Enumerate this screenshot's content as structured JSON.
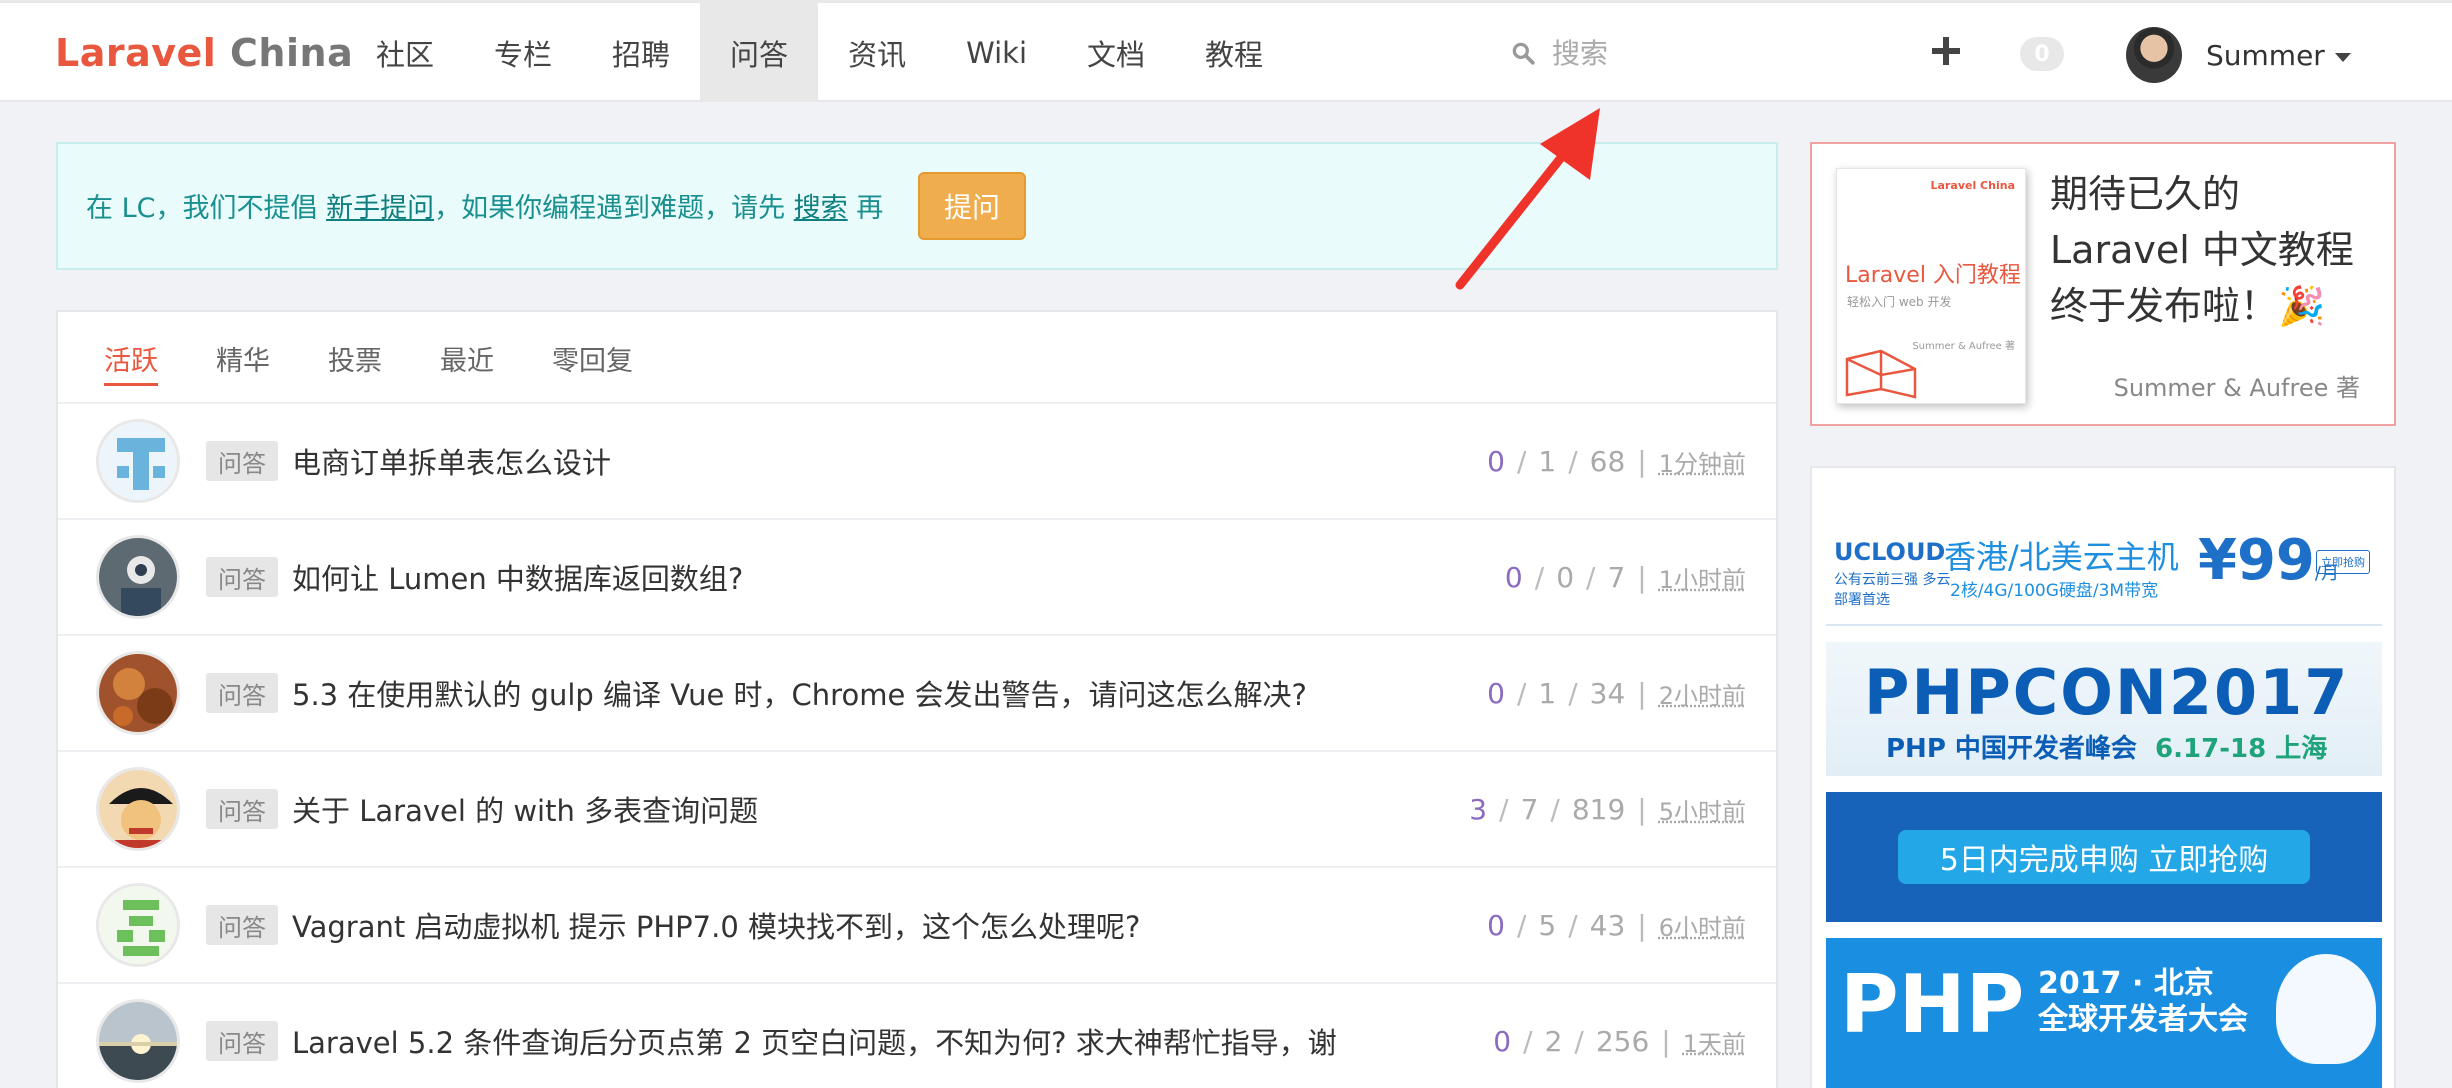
{
  "brand": {
    "part1": "Laravel",
    "part2": "China"
  },
  "nav": {
    "items": [
      "社区",
      "专栏",
      "招聘",
      "问答",
      "资讯",
      "Wiki",
      "文档",
      "教程"
    ],
    "active_index": 3
  },
  "search": {
    "placeholder": "搜索"
  },
  "header": {
    "notification_count": "0",
    "username": "Summer"
  },
  "notice": {
    "text_before": "在 LC，我们不提倡",
    "link1": "新手提问",
    "text_middle": "，如果你编程遇到难题，请先",
    "link2": "搜索",
    "text_after": "再",
    "button": "提问"
  },
  "filters": {
    "items": [
      "活跃",
      "精华",
      "投票",
      "最近",
      "零回复"
    ],
    "active_index": 0
  },
  "topics": [
    {
      "tag": "问答",
      "title": "电商订单拆单表怎么设计",
      "votes": "0",
      "replies": "1",
      "views": "68",
      "time": "1分钟前"
    },
    {
      "tag": "问答",
      "title": "如何让 Lumen 中数据库返回数组?",
      "votes": "0",
      "replies": "0",
      "views": "7",
      "time": "1小时前"
    },
    {
      "tag": "问答",
      "title": "5.3 在使用默认的 gulp 编译 Vue 时，Chrome 会发出警告，请问这怎么解决?",
      "votes": "0",
      "replies": "1",
      "views": "34",
      "time": "2小时前"
    },
    {
      "tag": "问答",
      "title": "关于 Laravel 的 with 多表查询问题",
      "votes": "3",
      "replies": "7",
      "views": "819",
      "time": "5小时前"
    },
    {
      "tag": "问答",
      "title": "Vagrant 启动虚拟机 提示 PHP7.0 模块找不到，这个怎么处理呢?",
      "votes": "0",
      "replies": "5",
      "views": "43",
      "time": "6小时前"
    },
    {
      "tag": "问答",
      "title": "Laravel 5.2 条件查询后分页点第 2 页空白问题，不知为何? 求大神帮忙指导，谢",
      "votes": "0",
      "replies": "2",
      "views": "256",
      "time": "1天前"
    }
  ],
  "promo": {
    "book_title": "Laravel 入门教程",
    "book_subtitle": "轻松入门 web 开发",
    "book_brand": "Laravel China",
    "book_authors": "Summer & Aufree 著",
    "line1": "期待已久的",
    "line2": "Laravel 中文教程",
    "line3": "终于发布啦！🎉",
    "author": "Summer & Aufree 著"
  },
  "ads": {
    "ucloud": {
      "brand": "UCLOUD",
      "tagline": "公有云前三强 多云部署首选",
      "headline": "香港/北美云主机",
      "specs": "2核/4G/100G硬盘/3M带宽",
      "price": "¥99",
      "unit": "/月",
      "cta": "立即抢购"
    },
    "phpcon": {
      "title": "PHPCON2017",
      "subtitle": "PHP 中国开发者峰会",
      "date": "6.17-18 上海"
    },
    "purchase": {
      "cta": "5日内完成申购  立即抢购"
    },
    "php_beijing": {
      "big": "PHP",
      "line1": "2017 · 北京",
      "line2": "全球开发者大会"
    }
  }
}
